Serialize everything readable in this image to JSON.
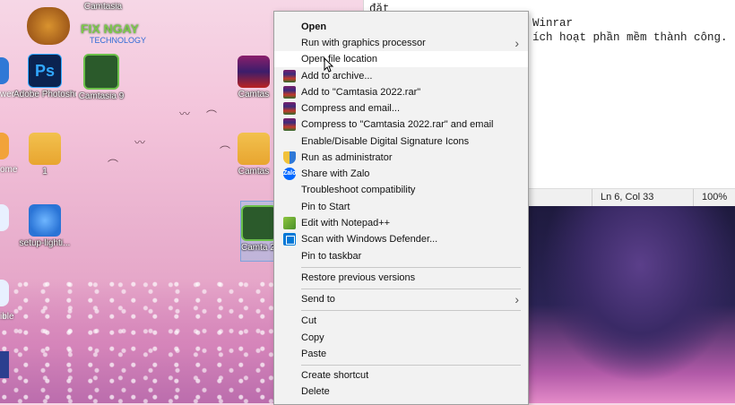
{
  "desktop": {
    "icons": [
      {
        "id": "camtasia-top",
        "label": "Camtasia"
      },
      {
        "id": "photoshop",
        "label": "Adobe Photosho..."
      },
      {
        "id": "camtasia-9",
        "label": "Camtasia 9"
      },
      {
        "id": "camtasia-rar-1",
        "label": "Camtas"
      },
      {
        "id": "folder-1",
        "label": "1"
      },
      {
        "id": "camtasia-rar-2",
        "label": "Camtas"
      },
      {
        "id": "setup-light",
        "label": "setup-lighti..."
      },
      {
        "id": "camtasia-2022",
        "label": "Camta 202"
      },
      {
        "id": "left-wer",
        "label": "wer"
      },
      {
        "id": "left-ome",
        "label": "ome"
      },
      {
        "id": "left-ible",
        "label": "ible"
      }
    ],
    "logo_text": "FIX NGAY",
    "logo_sub": "TECHNOLOGY"
  },
  "notepad": {
    "lines": [
      "đặt",
      "Winrar",
      "ích hoạt phần mềm thành công."
    ],
    "status": {
      "position": "Ln 6, Col 33",
      "zoom": "100%"
    }
  },
  "context_menu": {
    "items": [
      {
        "label": "Open",
        "bold": true
      },
      {
        "label": "Run with graphics processor",
        "submenu": true
      },
      {
        "label": "Open file location",
        "hover": true
      },
      {
        "label": "Add to archive...",
        "icon": "winrar-icon"
      },
      {
        "label": "Add to \"Camtasia 2022.rar\"",
        "icon": "winrar-icon"
      },
      {
        "label": "Compress and email...",
        "icon": "winrar-icon"
      },
      {
        "label": "Compress to \"Camtasia 2022.rar\" and email",
        "icon": "winrar-icon"
      },
      {
        "label": "Enable/Disable Digital Signature Icons"
      },
      {
        "label": "Run as administrator",
        "icon": "shield-icon"
      },
      {
        "label": "Share with Zalo",
        "icon": "zalo-icon"
      },
      {
        "label": "Troubleshoot compatibility"
      },
      {
        "label": "Pin to Start"
      },
      {
        "label": "Edit with Notepad++",
        "icon": "notepadpp-icon"
      },
      {
        "label": "Scan with Windows Defender...",
        "icon": "defender-icon"
      },
      {
        "label": "Pin to taskbar"
      },
      {
        "label": "Restore previous versions"
      },
      {
        "label": "Send to",
        "submenu": true
      },
      {
        "label": "Cut"
      },
      {
        "label": "Copy"
      },
      {
        "label": "Paste"
      },
      {
        "label": "Create shortcut"
      },
      {
        "label": "Delete"
      }
    ],
    "zalo_icon_text": "Zalo"
  }
}
